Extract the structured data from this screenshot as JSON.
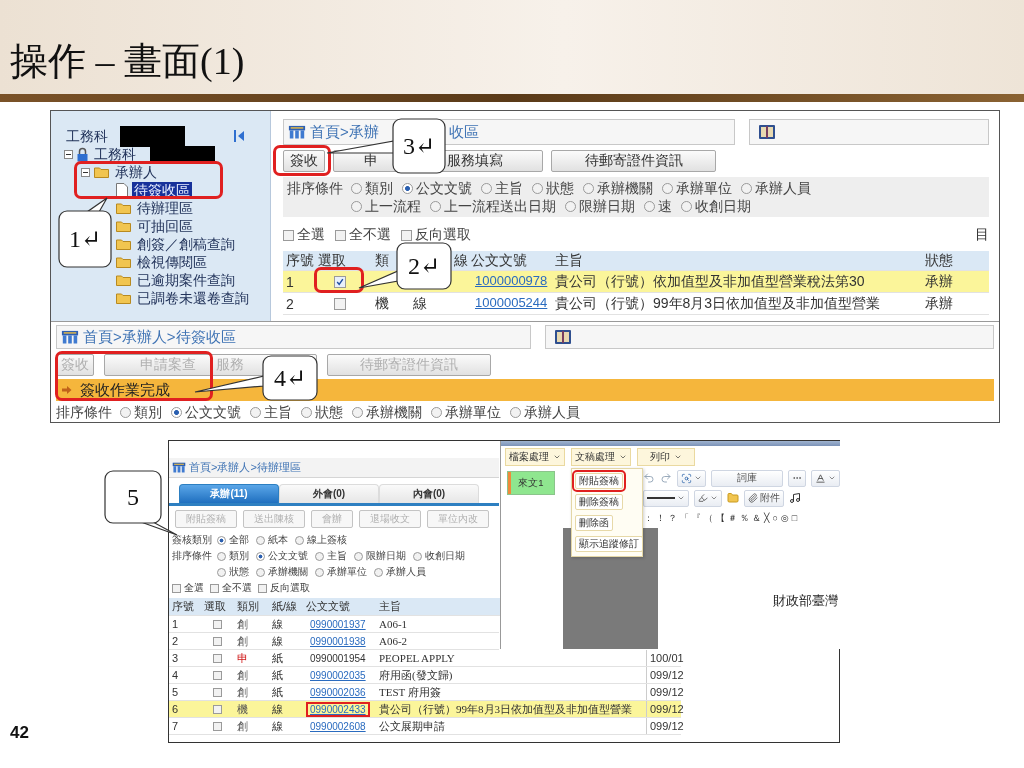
{
  "slide": {
    "title": "操作 – 畫面(1)",
    "page_number": "42"
  },
  "screen_1": {
    "tree": {
      "header": "工務科",
      "root": {
        "label": "工務科",
        "expanded": true,
        "children": [
          {
            "label": "承辦人",
            "expanded": true,
            "children": [
              {
                "label": "待簽收區",
                "kind": "page",
                "selected": true
              },
              {
                "label": "待辦理區",
                "kind": "folder",
                "selected": false
              },
              {
                "label": "可抽回區",
                "kind": "folder",
                "selected": false
              },
              {
                "label": "創簽／創稿查詢",
                "kind": "folder",
                "selected": false
              },
              {
                "label": "檢視傳閱區",
                "kind": "folder",
                "selected": false
              },
              {
                "label": "已逾期案件查詢",
                "kind": "folder",
                "selected": false
              },
              {
                "label": "已調卷未還卷查詢",
                "kind": "folder",
                "selected": false
              }
            ]
          }
        ]
      }
    },
    "breadcrumb_parts": [
      "首頁>承辦",
      "收區"
    ],
    "buttons": [
      {
        "parts": [
          "簽收"
        ],
        "disabled": false
      },
      {
        "parts": [
          "申",
          "服務填寫"
        ],
        "disabled": false
      },
      {
        "parts": [
          "待郵寄證件資訊"
        ],
        "disabled": false
      }
    ],
    "sort": {
      "label": "排序條件",
      "lines": [
        [
          {
            "label": "類別",
            "selected": false
          },
          {
            "label": "公文文號",
            "selected": true
          },
          {
            "label": "主旨",
            "selected": false
          },
          {
            "label": "狀態",
            "selected": false
          },
          {
            "label": "承辦機關",
            "selected": false
          },
          {
            "label": "承辦單位",
            "selected": false
          },
          {
            "label": "承辦人員",
            "selected": false
          }
        ],
        [
          {
            "label": "上一流程",
            "selected": false
          },
          {
            "label": "上一流程送出日期",
            "selected": false
          },
          {
            "label": "限辦日期",
            "selected": false
          },
          {
            "label": "速",
            "selected": false
          },
          {
            "label": "收創日期",
            "selected": false
          }
        ]
      ]
    },
    "select_options": [
      {
        "label": "全選",
        "checked": false
      },
      {
        "label": "全不選",
        "checked": false
      },
      {
        "label": "反向選取",
        "checked": false
      }
    ],
    "side_text": "目",
    "table": {
      "columns": [
        "序號",
        "選取",
        "類",
        "線",
        "公文文號",
        "主旨",
        "狀態"
      ],
      "rows": [
        {
          "no": "1",
          "checked": true,
          "highlighted": true,
          "doc_no": "1000000978",
          "subject": "貴公司（行號）依加值型及非加值型營業稅法第30",
          "status": "承辦"
        },
        {
          "no": "2",
          "checked": false,
          "highlighted": false,
          "category": "機",
          "medium": "線",
          "doc_no": "1000005244",
          "subject": "貴公司（行號）99年8月3日依加值型及非加值型營業",
          "status": "承辦"
        }
      ]
    },
    "result": {
      "breadcrumb": "首頁>承辦人>待簽收區",
      "buttons": [
        {
          "parts": [
            "簽收"
          ],
          "disabled": true
        },
        {
          "parts": [
            "申請案查",
            "服務"
          ],
          "disabled": true
        },
        {
          "parts": [
            "待郵寄證件資訊"
          ],
          "disabled": true
        }
      ],
      "message": "簽收作業完成",
      "sort": {
        "label": "排序條件",
        "lines": [
          [
            {
              "label": "類別",
              "selected": false
            },
            {
              "label": "公文文號",
              "selected": true
            },
            {
              "label": "主旨",
              "selected": false
            },
            {
              "label": "狀態",
              "selected": false
            },
            {
              "label": "承辦機關",
              "selected": false
            },
            {
              "label": "承辦單位",
              "selected": false
            },
            {
              "label": "承辦人員",
              "selected": false
            }
          ]
        ]
      }
    },
    "callouts": [
      "1↵",
      "3↵",
      "2↵",
      "4↵"
    ]
  },
  "screen_2": {
    "breadcrumb": "首頁>承辦人>待辦理區",
    "tabs": [
      {
        "label": "承辦(11)",
        "selected": true
      },
      {
        "label": "外會(0)",
        "selected": false
      },
      {
        "label": "內會(0)",
        "selected": false
      }
    ],
    "buttons": [
      {
        "label": "附貼簽稿",
        "disabled": true
      },
      {
        "label": "送出陳核",
        "disabled": true
      },
      {
        "label": "會辦",
        "disabled": true
      },
      {
        "label": "退場收文",
        "disabled": true
      },
      {
        "label": "單位內改",
        "disabled": true
      }
    ],
    "filters": [
      {
        "label": "簽核類別",
        "lines": [
          [
            {
              "label": "全部",
              "selected": true
            },
            {
              "label": "紙本",
              "selected": false
            },
            {
              "label": "線上簽核",
              "selected": false
            }
          ]
        ]
      },
      {
        "label": "排序條件",
        "lines": [
          [
            {
              "label": "類別",
              "selected": false
            },
            {
              "label": "公文文號",
              "selected": true
            },
            {
              "label": "主旨",
              "selected": false
            },
            {
              "label": "限辦日期",
              "selected": false
            },
            {
              "label": "收創日期",
              "selected": false
            }
          ],
          [
            {
              "label": "狀態",
              "selected": false
            },
            {
              "label": "承辦機關",
              "selected": false
            },
            {
              "label": "承辦單位",
              "selected": false
            },
            {
              "label": "承辦人員",
              "selected": false
            }
          ]
        ]
      }
    ],
    "select_options": [
      {
        "label": "全選",
        "checked": false
      },
      {
        "label": "全不選",
        "checked": false
      },
      {
        "label": "反向選取",
        "checked": false
      }
    ],
    "table": {
      "columns": [
        "序號",
        "選取",
        "類別",
        "紙/線",
        "公文文號",
        "主旨"
      ],
      "rows": [
        {
          "no": "1",
          "checked": false,
          "category": "創",
          "emphasized": false,
          "medium": "線",
          "doc_no": "0990001937",
          "linked": true,
          "highlighted": false,
          "annotated": false,
          "subject": "A06-1"
        },
        {
          "no": "2",
          "checked": false,
          "category": "創",
          "emphasized": false,
          "medium": "線",
          "doc_no": "0990001938",
          "linked": true,
          "highlighted": false,
          "annotated": false,
          "subject": "A06-2"
        },
        {
          "no": "3",
          "checked": false,
          "category": "申",
          "emphasized": true,
          "medium": "紙",
          "doc_no": "0990001954",
          "linked": false,
          "highlighted": false,
          "annotated": false,
          "subject": "PEOPEL APPLY",
          "date": "100/01"
        },
        {
          "no": "4",
          "checked": false,
          "category": "創",
          "emphasized": false,
          "medium": "紙",
          "doc_no": "0990002035",
          "linked": true,
          "highlighted": false,
          "annotated": false,
          "subject": "府用函(發文歸)",
          "date": "099/12"
        },
        {
          "no": "5",
          "checked": false,
          "category": "創",
          "emphasized": false,
          "medium": "紙",
          "doc_no": "0990002036",
          "linked": true,
          "highlighted": false,
          "annotated": false,
          "subject": "TEST 府用簽",
          "date": "099/12"
        },
        {
          "no": "6",
          "checked": false,
          "category": "機",
          "emphasized": false,
          "medium": "線",
          "doc_no": "0990002433",
          "linked": true,
          "highlighted": true,
          "annotated": true,
          "subject": "貴公司（行號）99年8月3日依加值型及非加值型營業",
          "date": "099/12"
        },
        {
          "no": "7",
          "checked": false,
          "category": "創",
          "emphasized": false,
          "medium": "線",
          "doc_no": "0990002608",
          "linked": true,
          "highlighted": false,
          "annotated": false,
          "subject": "公文展期申請",
          "date": "099/12"
        }
      ]
    },
    "editor": {
      "menus": [
        "檔案處理",
        "文稿處理",
        "列印"
      ],
      "document_tab": "來文1",
      "menu_items": [
        {
          "label": "附貼簽稿",
          "annotated": true
        },
        {
          "label": "刪除簽稿",
          "annotated": false
        },
        {
          "label": "刪除函",
          "annotated": false
        },
        {
          "label": "顯示追蹤修訂",
          "annotated": false
        }
      ],
      "word_field": "詞庫",
      "attach_label": "附件",
      "symbols": [
        "：",
        "！",
        "？",
        "「",
        "『",
        "（",
        "【",
        "＃",
        "％",
        "＆",
        "╳",
        "○",
        "◎",
        "□"
      ],
      "document_text": "財政部臺灣"
    },
    "callout": "5"
  }
}
